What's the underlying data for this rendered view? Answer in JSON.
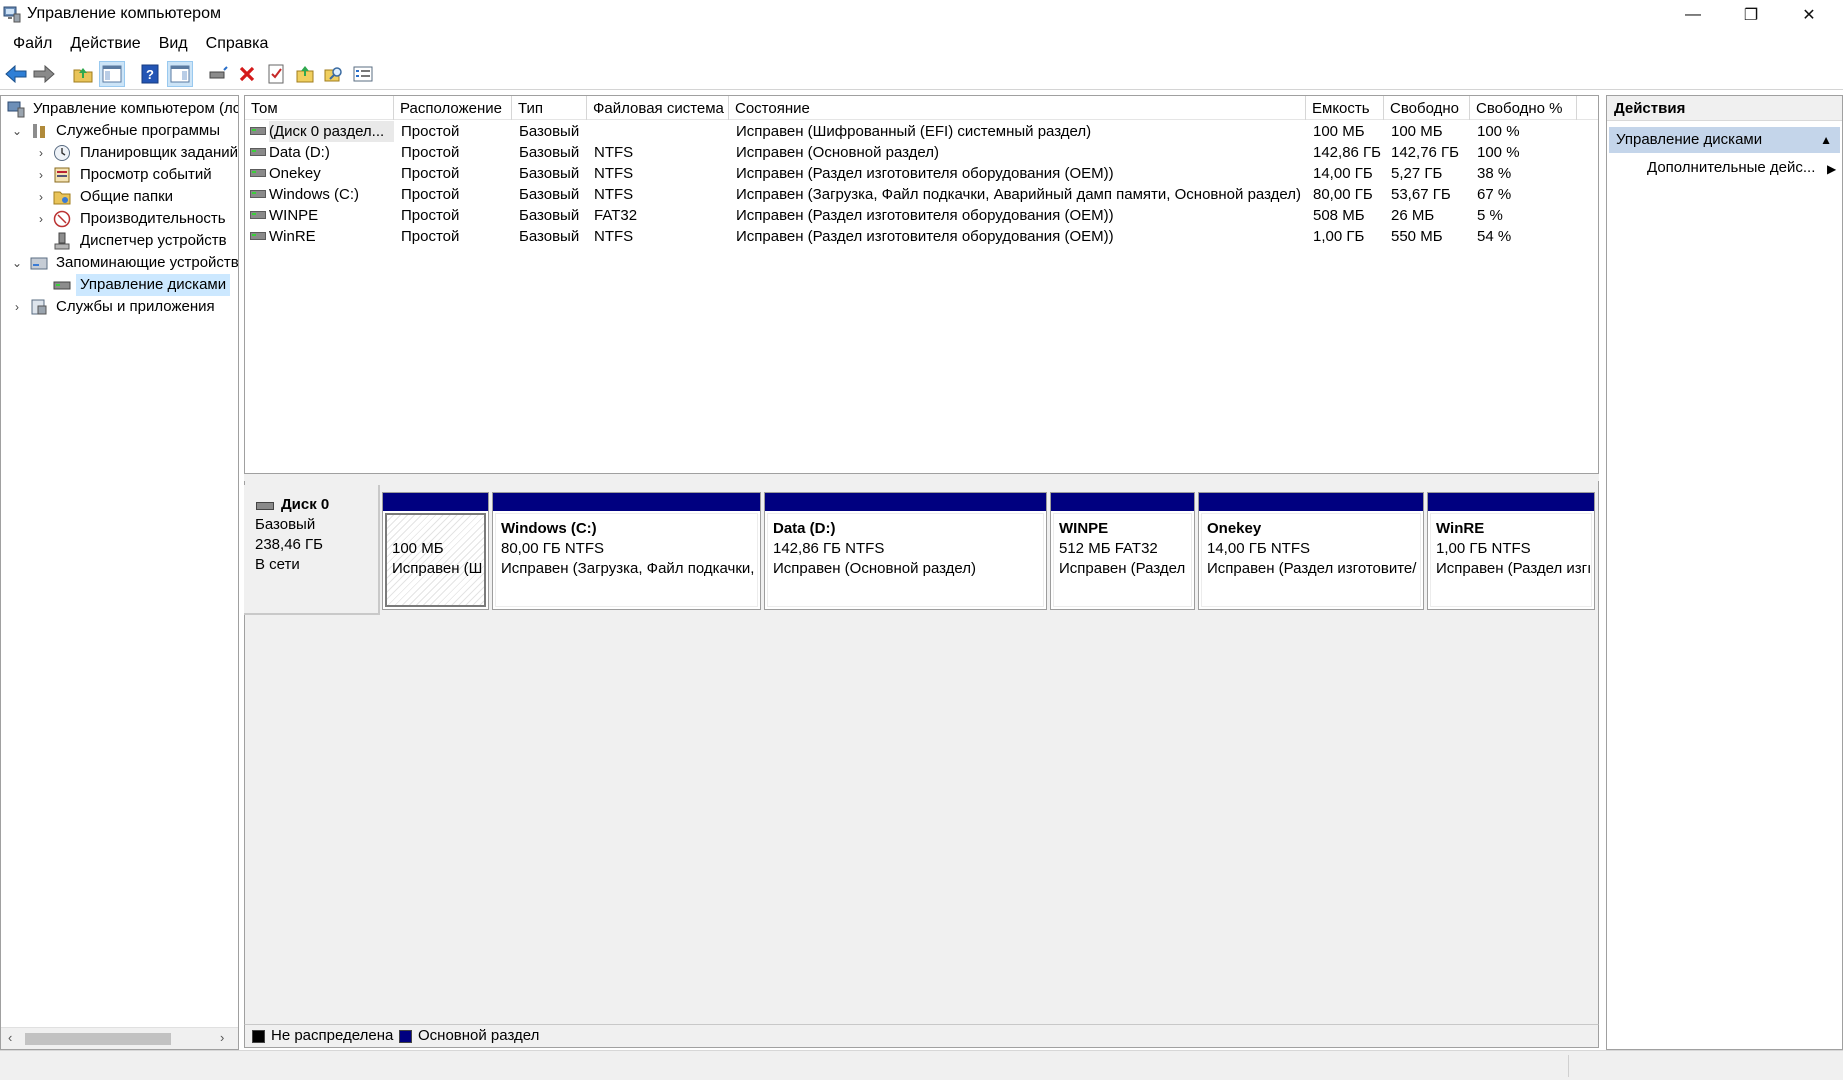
{
  "window": {
    "title": "Управление компьютером",
    "minimize": "—",
    "restore": "❐",
    "close": "✕"
  },
  "menu": [
    "Файл",
    "Действие",
    "Вид",
    "Справка"
  ],
  "tree": {
    "root": "Управление компьютером (лс",
    "utilities": "Служебные программы",
    "task_scheduler": "Планировщик заданий",
    "event_viewer": "Просмотр событий",
    "shared_folders": "Общие папки",
    "performance": "Производительность",
    "device_manager": "Диспетчер устройств",
    "storage": "Запоминающие устройств",
    "disk_management": "Управление дисками",
    "services_apps": "Службы и приложения"
  },
  "volumes": {
    "columns": [
      "Том",
      "Расположение",
      "Тип",
      "Файловая система",
      "Состояние",
      "Емкость",
      "Свободно",
      "Свободно %"
    ],
    "rows": [
      {
        "name": "(Диск 0 раздел...",
        "layout": "Простой",
        "type": "Базовый",
        "fs": "",
        "status": "Исправен (Шифрованный (EFI) системный раздел)",
        "capacity": "100 МБ",
        "free": "100 МБ",
        "free_pct": "100 %"
      },
      {
        "name": "Data (D:)",
        "layout": "Простой",
        "type": "Базовый",
        "fs": "NTFS",
        "status": "Исправен (Основной раздел)",
        "capacity": "142,86 ГБ",
        "free": "142,76 ГБ",
        "free_pct": "100 %"
      },
      {
        "name": "Onekey",
        "layout": "Простой",
        "type": "Базовый",
        "fs": "NTFS",
        "status": "Исправен (Раздел изготовителя оборудования (OEM))",
        "capacity": "14,00 ГБ",
        "free": "5,27 ГБ",
        "free_pct": "38 %"
      },
      {
        "name": "Windows (C:)",
        "layout": "Простой",
        "type": "Базовый",
        "fs": "NTFS",
        "status": "Исправен (Загрузка, Файл подкачки, Аварийный дамп памяти, Основной раздел)",
        "capacity": "80,00 ГБ",
        "free": "53,67 ГБ",
        "free_pct": "67 %"
      },
      {
        "name": "WINPE",
        "layout": "Простой",
        "type": "Базовый",
        "fs": "FAT32",
        "status": "Исправен (Раздел изготовителя оборудования (OEM))",
        "capacity": "508 МБ",
        "free": "26 МБ",
        "free_pct": "5 %"
      },
      {
        "name": "WinRE",
        "layout": "Простой",
        "type": "Базовый",
        "fs": "NTFS",
        "status": "Исправен (Раздел изготовителя оборудования (OEM))",
        "capacity": "1,00 ГБ",
        "free": "550 МБ",
        "free_pct": "54 %"
      }
    ]
  },
  "disk": {
    "name": "Диск 0",
    "type": "Базовый",
    "size": "238,46 ГБ",
    "state": "В сети",
    "partitions": [
      {
        "title": "",
        "size": "100 МБ",
        "status": "Исправен (Ш"
      },
      {
        "title": "Windows  (C:)",
        "size": "80,00 ГБ NTFS",
        "status": "Исправен (Загрузка, Файл подкачки,"
      },
      {
        "title": "Data  (D:)",
        "size": "142,86 ГБ NTFS",
        "status": "Исправен (Основной раздел)"
      },
      {
        "title": "WINPE",
        "size": "512 МБ FAT32",
        "status": "Исправен (Раздел"
      },
      {
        "title": "Onekey",
        "size": "14,00 ГБ NTFS",
        "status": "Исправен (Раздел изготовите/"
      },
      {
        "title": "WinRE",
        "size": "1,00 ГБ NTFS",
        "status": "Исправен (Раздел изгı"
      }
    ]
  },
  "legend": {
    "unallocated": "Не распределена",
    "primary": "Основной раздел",
    "unallocated_color": "#000000",
    "primary_color": "#000080"
  },
  "actions": {
    "header": "Действия",
    "group": "Управление дисками",
    "more": "Дополнительные дейс..."
  }
}
